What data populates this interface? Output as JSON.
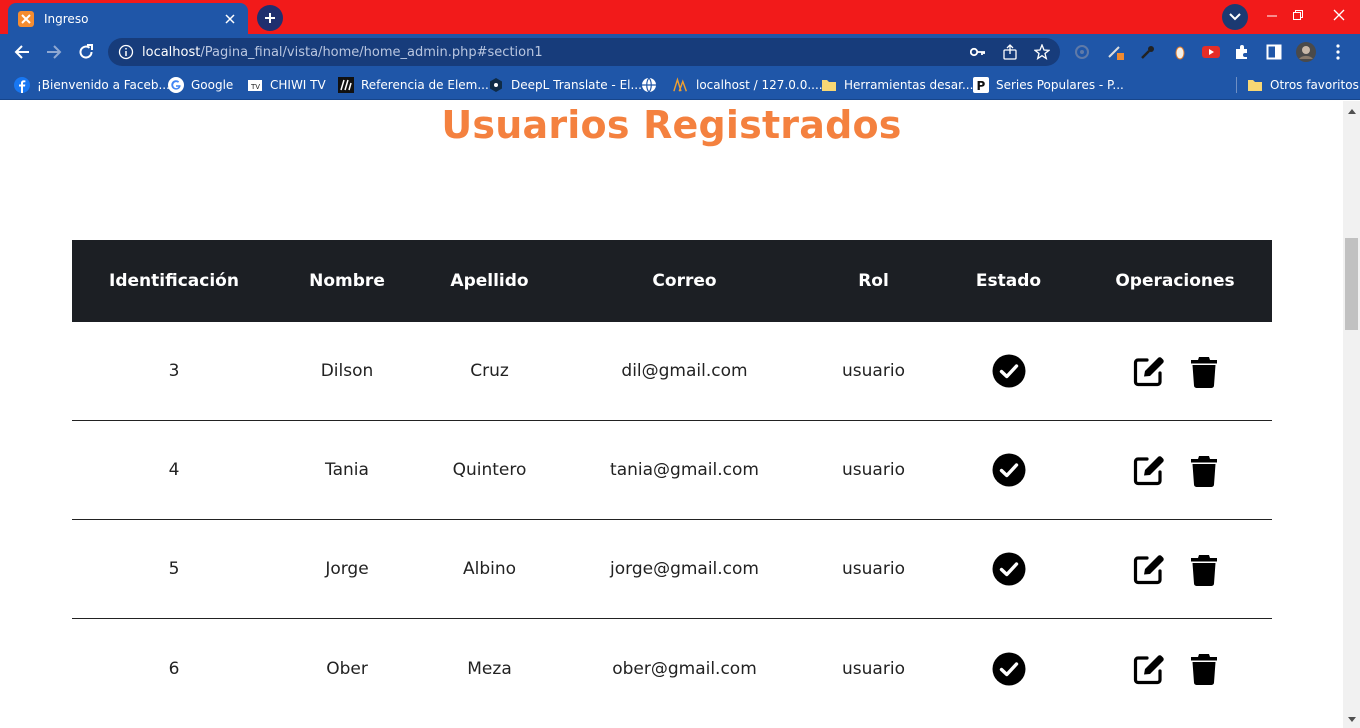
{
  "browser": {
    "tab_title": "Ingreso",
    "url_host": "localhost",
    "url_path": "/Pagina_final/vista/home/home_admin.php#section1",
    "bookmarks": [
      {
        "label": "¡Bienvenido a Faceb...",
        "icon": "facebook-icon"
      },
      {
        "label": "Google",
        "icon": "google-icon"
      },
      {
        "label": "CHIWI TV",
        "icon": "tv-icon"
      },
      {
        "label": "Referencia de Elem...",
        "icon": "mdn-icon"
      },
      {
        "label": "DeepL Translate - El...",
        "icon": "deepl-icon"
      },
      {
        "label": "",
        "icon": "globe-icon"
      },
      {
        "label": "localhost / 127.0.0....",
        "icon": "phpmyadmin-icon"
      },
      {
        "label": "Herramientas desar...",
        "icon": "folder-icon"
      },
      {
        "label": "Series Populares - P...",
        "icon": "p-icon"
      }
    ],
    "other_bookmarks": "Otros favoritos",
    "colors": {
      "tabstrip": "#f21a1a",
      "toolbar": "#1f56a8"
    }
  },
  "page": {
    "title": "Usuarios Registrados",
    "title_color": "#f4813f",
    "headers": [
      "Identificación",
      "Nombre",
      "Apellido",
      "Correo",
      "Rol",
      "Estado",
      "Operaciones"
    ],
    "rows": [
      {
        "id": "3",
        "nombre": "Dilson",
        "apellido": "Cruz",
        "correo": "dil@gmail.com",
        "rol": "usuario",
        "estado": "check-circle-icon"
      },
      {
        "id": "4",
        "nombre": "Tania",
        "apellido": "Quintero",
        "correo": "tania@gmail.com",
        "rol": "usuario",
        "estado": "check-circle-icon"
      },
      {
        "id": "5",
        "nombre": "Jorge",
        "apellido": "Albino",
        "correo": "jorge@gmail.com",
        "rol": "usuario",
        "estado": "check-circle-icon"
      },
      {
        "id": "6",
        "nombre": "Ober",
        "apellido": "Meza",
        "correo": "ober@gmail.com",
        "rol": "usuario",
        "estado": "check-circle-icon"
      }
    ],
    "operations": [
      "edit-icon",
      "trash-icon"
    ]
  }
}
